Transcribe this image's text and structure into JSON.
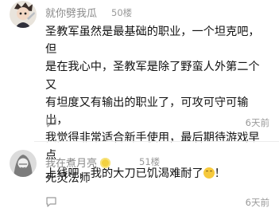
{
  "comments": [
    {
      "username": "就你劈我瓜",
      "floor": "50楼",
      "text_lines": [
        "圣教军虽然是最基础的职业，一个坦克吧，但",
        "是在我心中，圣教军是除了野蛮人外第二个又",
        "有坦度又有输出的职业了，可攻可守可输出，",
        "我觉得非常适合新手使用，最后期待游戏早点",
        "上线吧，我的大刀已饥渴难耐了"
      ],
      "text_end": "！",
      "time": "6天前",
      "has_badge": false,
      "emoji": "sweat-smile-emoji"
    },
    {
      "username": "我在煮月亮",
      "floor": "51楼",
      "text_lines": [
        "死灵法师"
      ],
      "time": "6天前",
      "has_badge": true
    }
  ],
  "colors": {
    "meta_text": "#8a8a8a",
    "badge": "#f3d13f",
    "divider": "#ececec"
  }
}
